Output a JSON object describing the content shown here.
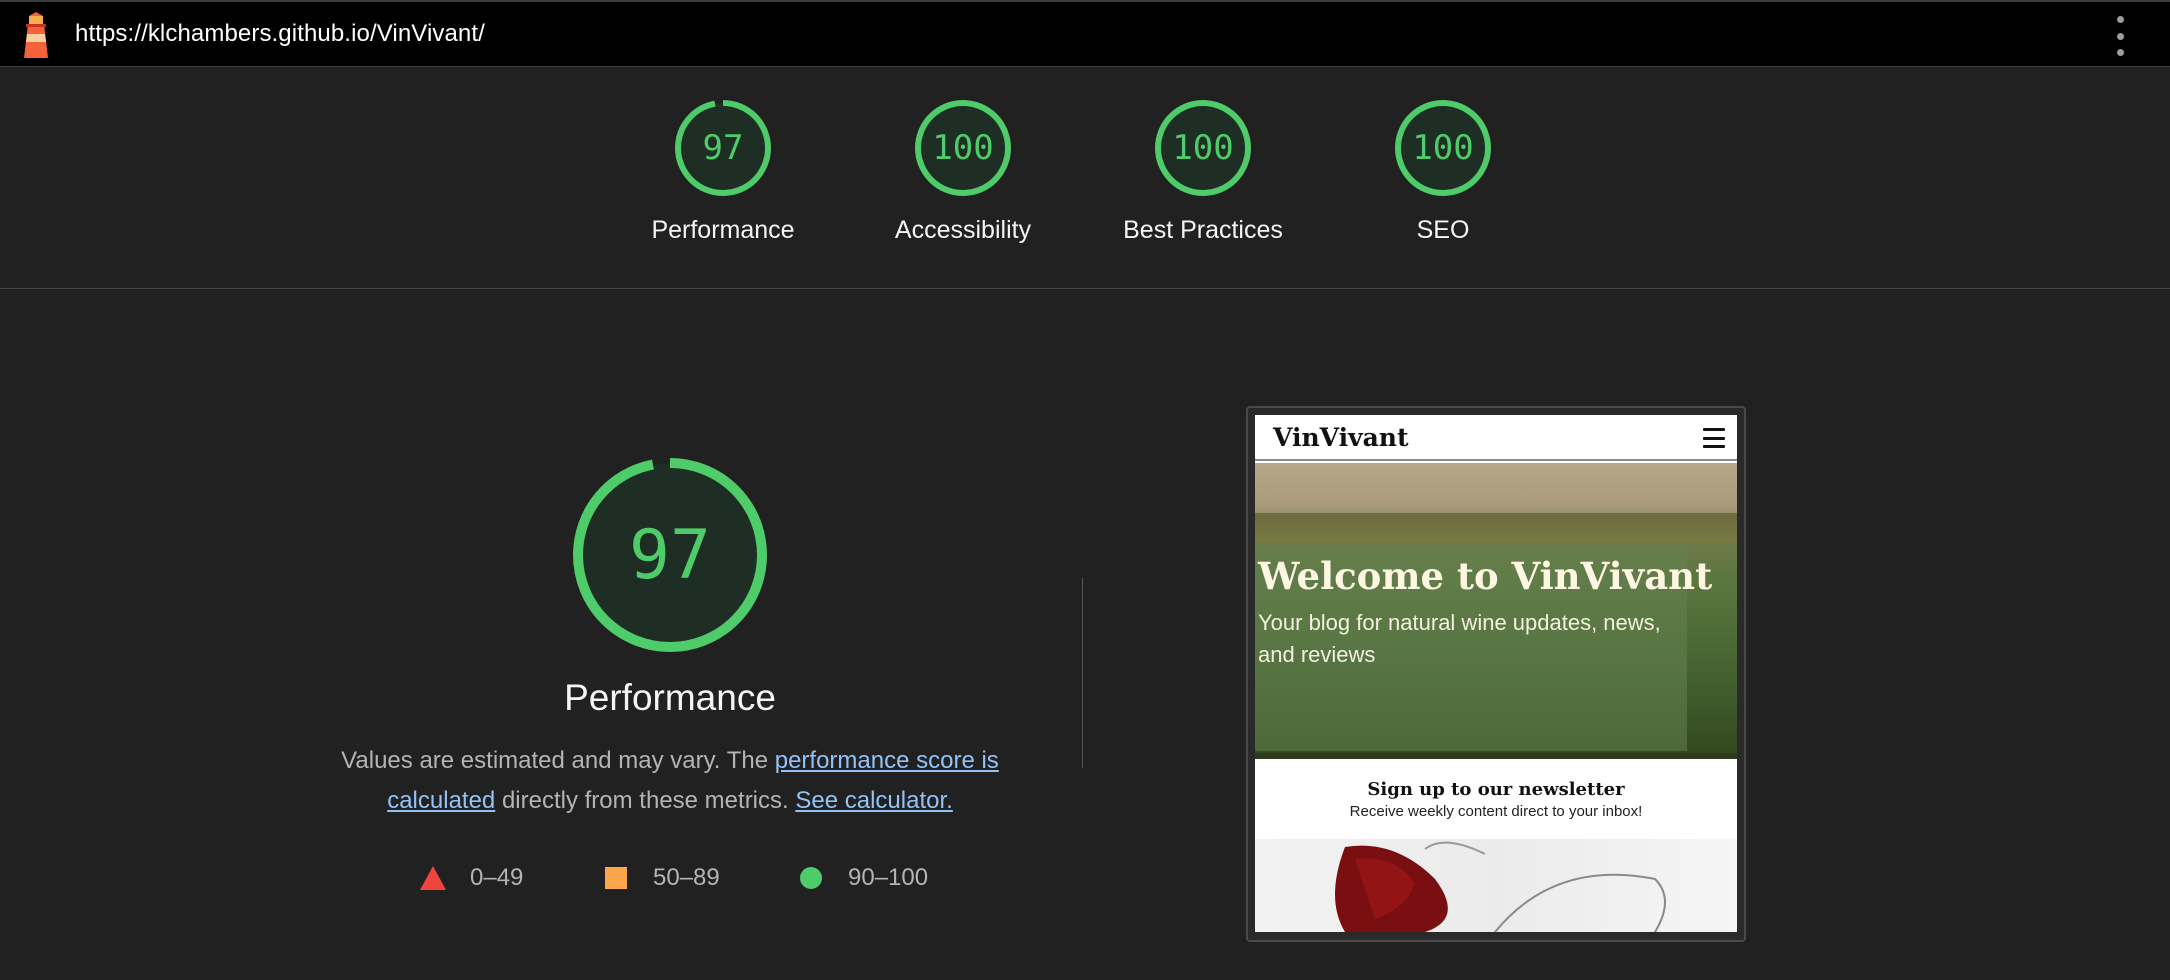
{
  "topbar": {
    "url": "https://klchambers.github.io/VinVivant/"
  },
  "scores": [
    {
      "value": "97",
      "label": "Performance",
      "fraction": 0.97
    },
    {
      "value": "100",
      "label": "Accessibility",
      "fraction": 1.0
    },
    {
      "value": "100",
      "label": "Best Practices",
      "fraction": 1.0
    },
    {
      "value": "100",
      "label": "SEO",
      "fraction": 1.0
    }
  ],
  "performance": {
    "score": "97",
    "fraction": 0.97,
    "title": "Performance",
    "desc_prefix": "Values are estimated and may vary. The ",
    "link_score": "performance score is calculated",
    "desc_middle": " directly from these metrics.",
    "link_calc": "See calculator."
  },
  "legend": {
    "fail": "0–49",
    "average": "50–89",
    "pass": "90–100"
  },
  "colors": {
    "pass": "#4ecc69",
    "average": "#f9a74a",
    "fail": "#f0453e",
    "link": "#93c2f6"
  },
  "screenshot": {
    "brand": "VinVivant",
    "hero_title": "Welcome to VinVivant",
    "hero_subtitle": "Your blog for natural wine updates, news, and reviews",
    "newsletter_title": "Sign up to our newsletter",
    "newsletter_subtitle": "Receive weekly content direct to your inbox!"
  }
}
